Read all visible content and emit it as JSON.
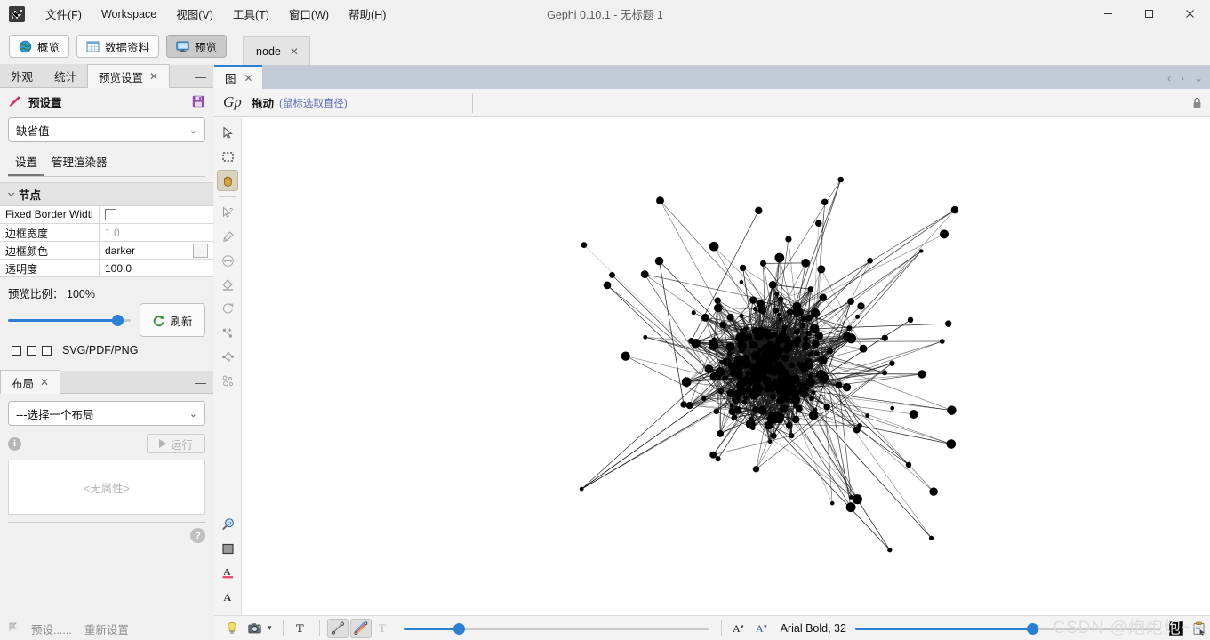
{
  "window": {
    "title": "Gephi 0.10.1 - 无标题 1",
    "minimize": "—",
    "maximize": "☐",
    "close": "✕"
  },
  "menu": {
    "items": [
      {
        "label": "文件(F)",
        "name": "menu-file"
      },
      {
        "label": "Workspace",
        "name": "menu-workspace"
      },
      {
        "label": "视图(V)",
        "name": "menu-view"
      },
      {
        "label": "工具(T)",
        "name": "menu-tools"
      },
      {
        "label": "窗口(W)",
        "name": "menu-window"
      },
      {
        "label": "帮助(H)",
        "name": "menu-help"
      }
    ]
  },
  "toolbar": {
    "buttons": [
      {
        "label": "概览",
        "icon": "globe-icon",
        "active": false
      },
      {
        "label": "数据资料",
        "icon": "table-icon",
        "active": false
      },
      {
        "label": "预览",
        "icon": "monitor-icon",
        "active": true
      }
    ],
    "workspace_tab": {
      "label": "node",
      "close": "✕"
    },
    "nav": {
      "prev": "‹",
      "next": "›",
      "more": "⌄"
    }
  },
  "left_panel": {
    "tabs": [
      {
        "label": "外观",
        "active": false
      },
      {
        "label": "统计",
        "active": false
      },
      {
        "label": "预览设置",
        "active": true,
        "close": "✕"
      }
    ],
    "minimize": "—",
    "preset": {
      "title": "预设置",
      "pencil_icon": "pencil-icon",
      "save_icon": "save-icon",
      "selected": "缺省值",
      "chevron": "⌄"
    },
    "sub_tabs": [
      {
        "label": "设置",
        "active": true
      },
      {
        "label": "管理渲染器",
        "active": false
      }
    ],
    "section": {
      "title": "节点",
      "collapse_icon": "chevron-down-icon",
      "rows": [
        {
          "key": "Fixed Border Widtl",
          "value": "",
          "type": "checkbox",
          "checked": false
        },
        {
          "key": "边框宽度",
          "value": "1.0",
          "type": "text",
          "muted": true
        },
        {
          "key": "边框颜色",
          "value": "darker",
          "type": "picker",
          "button": "..."
        },
        {
          "key": "透明度",
          "value": "100.0",
          "type": "text",
          "muted": false
        }
      ]
    },
    "ratio": {
      "label": "预览比例：",
      "value": "100%",
      "slider_percent": 90
    },
    "refresh": {
      "label": "刷新",
      "icon": "refresh-icon"
    },
    "export": {
      "label": "SVG/PDF/PNG",
      "boxes": 3
    }
  },
  "layout_panel": {
    "tab": {
      "label": "布局",
      "close": "✕"
    },
    "minimize": "—",
    "selected_layout": "---选择一个布局",
    "chevron": "⌄",
    "info_icon": "info-icon",
    "run": {
      "label": "运行",
      "icon": "play-icon",
      "disabled": true
    },
    "properties_placeholder": "<无属性>",
    "help_icon": "help-icon"
  },
  "left_footer": {
    "preset_label": "预设......",
    "reset_label": "重新设置",
    "flag_icon": "flag-icon"
  },
  "graph_panel": {
    "tab": {
      "label": "图",
      "close": "✕"
    },
    "nav": {
      "prev": "‹",
      "next": "›",
      "more": "⌄"
    },
    "toolbar": {
      "logo_icon": "gephi-script-logo-icon",
      "mode_label": "拖动",
      "mode_hint": "(鼠标选取直径)",
      "lock_icon": "lock-icon"
    },
    "vertical_tools": [
      {
        "name": "cursor-tool",
        "icon": "arrow-cursor-icon",
        "selected": false
      },
      {
        "name": "rectangle-select-tool",
        "icon": "dashed-rectangle-icon",
        "selected": false
      },
      {
        "name": "drag-hand-tool",
        "icon": "hand-icon",
        "selected": true
      },
      {
        "name": "node-info-tool",
        "icon": "cursor-question-icon",
        "selected": false
      },
      {
        "name": "brush-tool",
        "icon": "brush-icon",
        "selected": false
      },
      {
        "name": "size-tool",
        "icon": "size-arrows-icon",
        "selected": false
      },
      {
        "name": "paint-bucket-tool",
        "icon": "paint-bucket-icon",
        "selected": false
      },
      {
        "name": "rotate-tool",
        "icon": "rotate-icon",
        "selected": false
      },
      {
        "name": "edge-create-tool",
        "icon": "edge-plus-icon",
        "selected": false
      },
      {
        "name": "shortest-path-tool",
        "icon": "shortest-path-icon",
        "selected": false
      },
      {
        "name": "heatmap-tool",
        "icon": "cluster-circles-icon",
        "selected": false
      }
    ],
    "vertical_tools_bottom": [
      {
        "name": "zoom-tool",
        "icon": "magnifier-icon"
      },
      {
        "name": "background-color-tool",
        "icon": "gray-square-icon"
      },
      {
        "name": "label-color-tool",
        "icon": "letter-a-underline-pink-icon"
      },
      {
        "name": "label-font-tool",
        "icon": "letter-a-icon"
      }
    ],
    "status_bar": {
      "bulb_icon": "lightbulb-icon",
      "screenshot_icon": "camera-icon",
      "screenshot_chevron": "▾",
      "node_labels_icon": "bold-T-icon",
      "edges_icon": "edge-line-icon",
      "edge_color_icon": "rainbow-edge-icon",
      "edge_labels_icon": "outline-T-icon",
      "edge_slider_percent": 18,
      "font_decrease_icon": "A-smaller-icon",
      "font_increase_icon": "A-blue-icon",
      "font_label": "Arial Bold, 32",
      "font_slider_percent": 58,
      "color_swatch": "#000000",
      "attributes_icon": "clipboard-cursor-icon"
    }
  },
  "chart_data": {
    "type": "scatter",
    "title": "",
    "description": "Dense force-directed network graph rendered in the Gephi preview panel: black circular nodes connected by thin dark edges forming a roughly square cloud with a dense core.",
    "node_color": "#000000",
    "edge_color": "#1a1a1a",
    "background": "#ffffff",
    "node_count": 320,
    "edge_count": 1450
  },
  "watermark": "CSDN @炮炮炮~~"
}
